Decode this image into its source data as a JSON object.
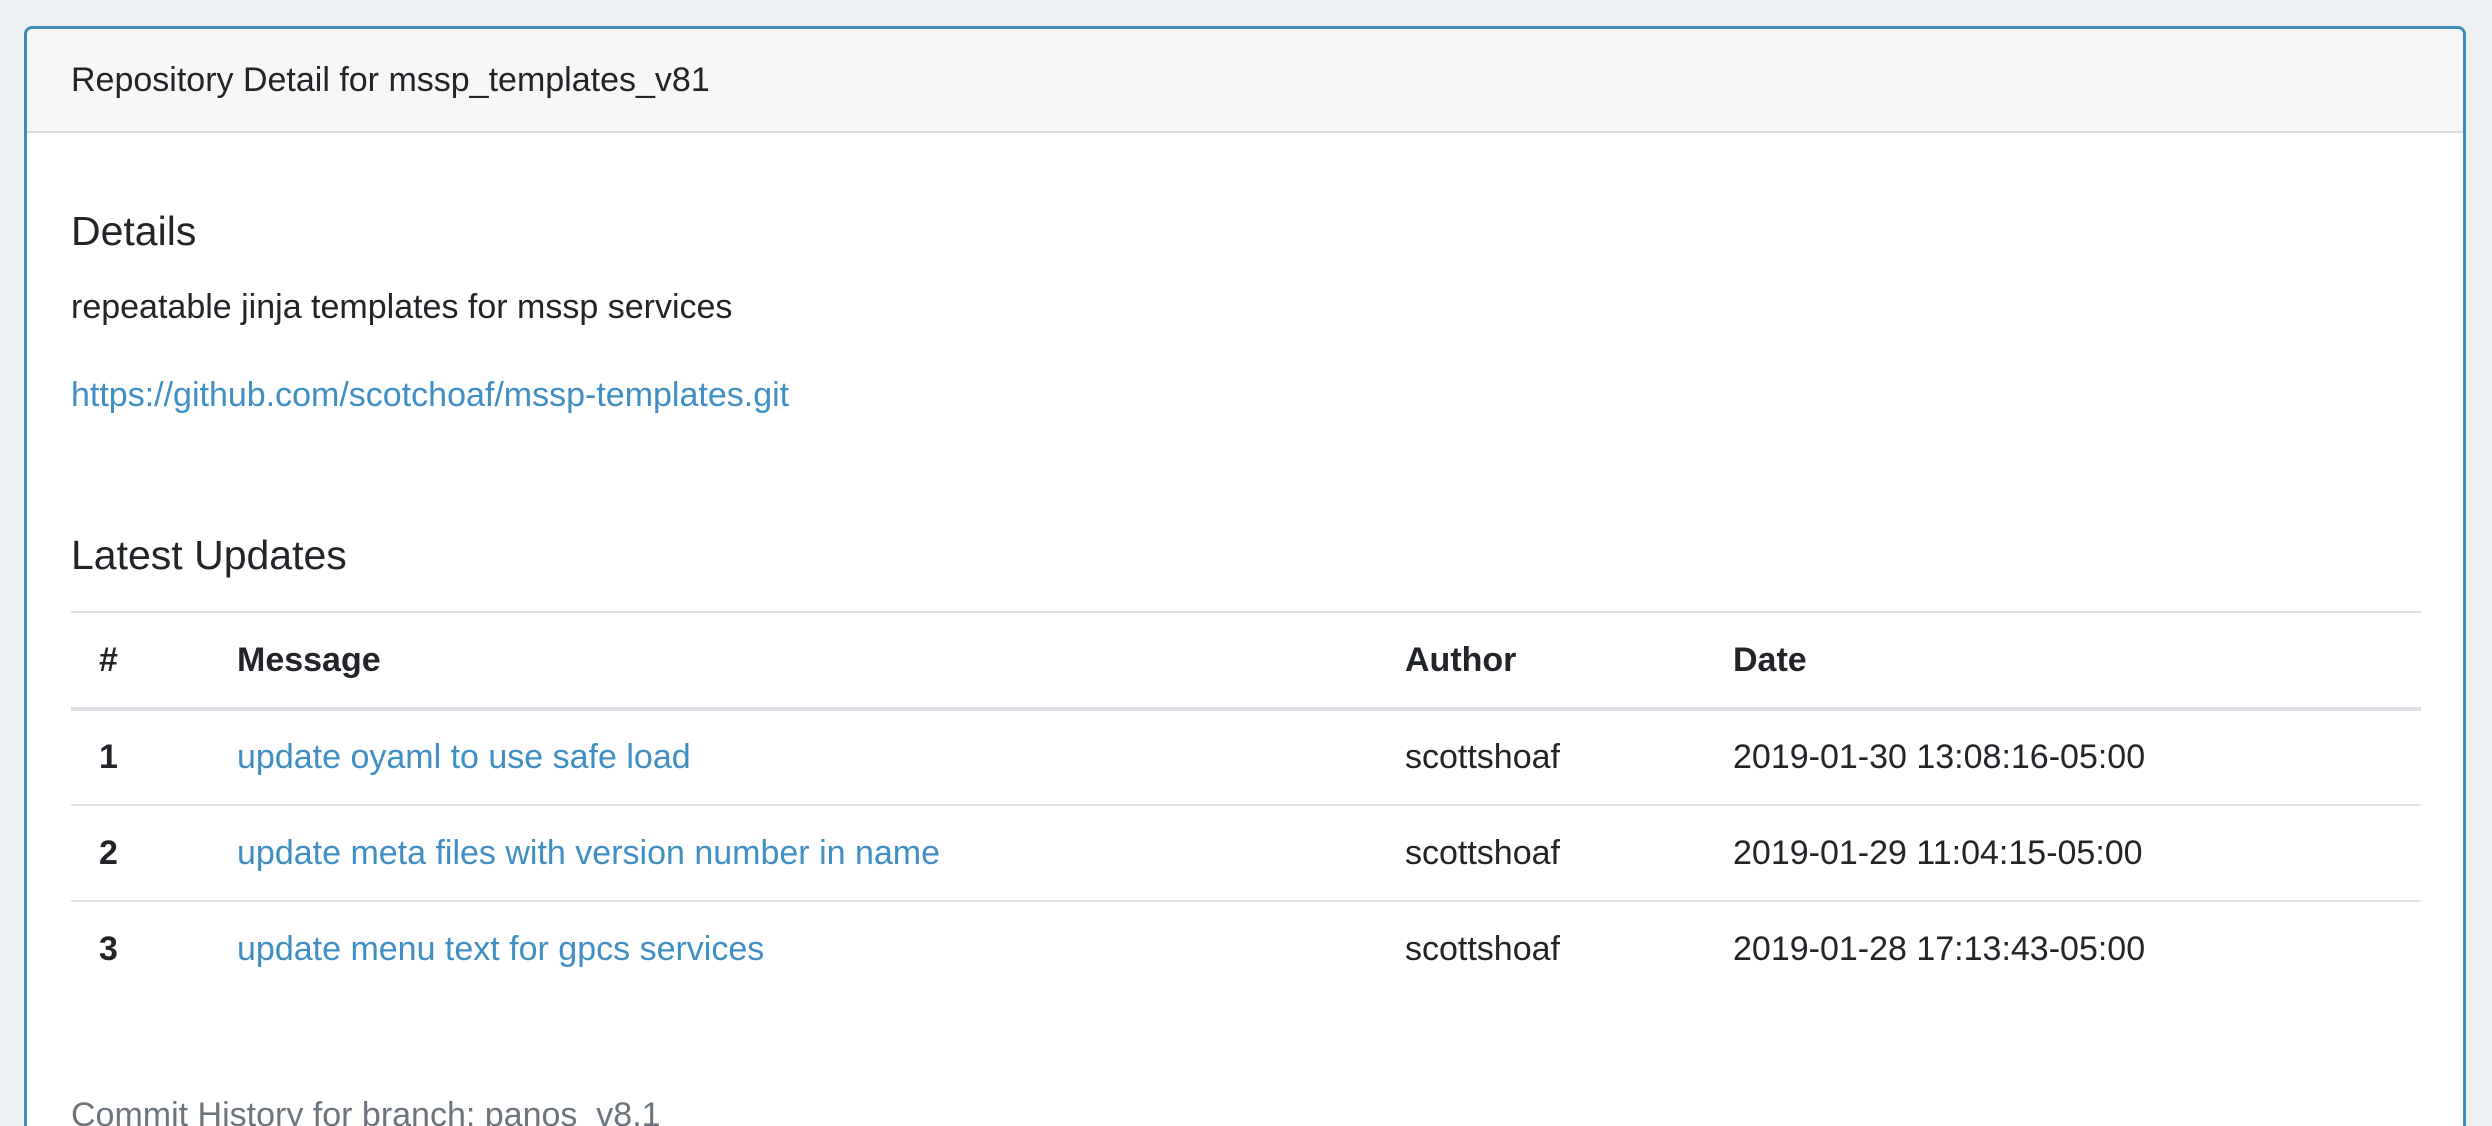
{
  "card": {
    "header_title": "Repository Detail for mssp_templates_v81"
  },
  "details": {
    "heading": "Details",
    "description": "repeatable jinja templates for mssp services",
    "repo_url": "https://github.com/scotchoaf/mssp-templates.git"
  },
  "updates": {
    "heading": "Latest Updates",
    "columns": {
      "num": "#",
      "message": "Message",
      "author": "Author",
      "date": "Date"
    },
    "rows": [
      {
        "num": "1",
        "message": "update oyaml to use safe load",
        "author": "scottshoaf",
        "date": "2019-01-30 13:08:16-05:00"
      },
      {
        "num": "2",
        "message": "update meta files with version number in name",
        "author": "scottshoaf",
        "date": "2019-01-29 11:04:15-05:00"
      },
      {
        "num": "3",
        "message": "update menu text for gpcs services",
        "author": "scottshoaf",
        "date": "2019-01-28 17:13:43-05:00"
      }
    ],
    "footer_note": "Commit History for branch: panos_v8.1"
  },
  "colors": {
    "link": "#3f8fc4",
    "card_border": "#3c8dbc",
    "muted_text": "#6c757d"
  }
}
